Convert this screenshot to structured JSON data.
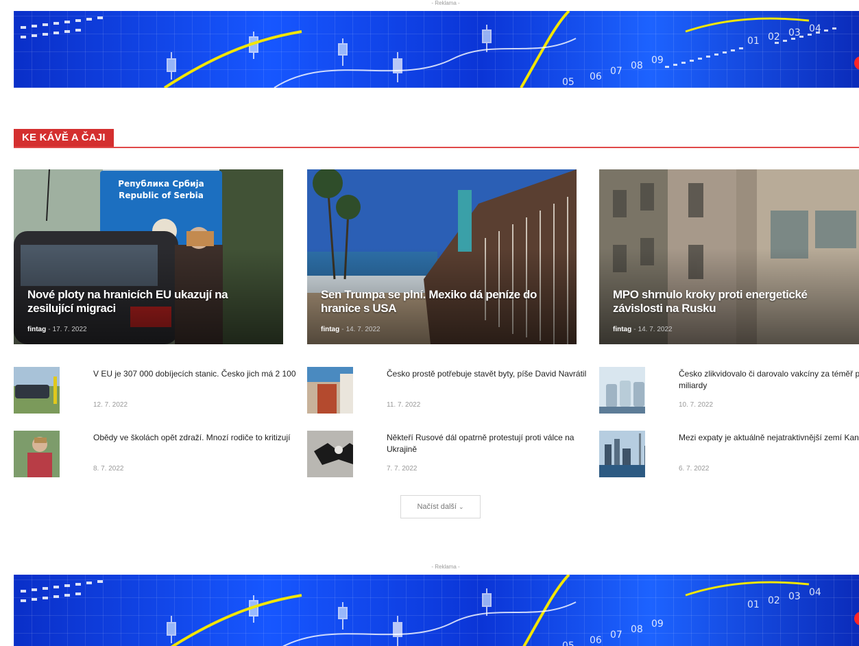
{
  "ads": {
    "top_label": "- Reklama -",
    "bottom_label": "- Reklama -",
    "banner_numbers": [
      "05",
      "06",
      "07",
      "08",
      "09",
      "01",
      "02",
      "03",
      "04"
    ]
  },
  "section": {
    "title": "KE KÁVĚ A ČAJI"
  },
  "features": [
    {
      "title": "Nové ploty na hranicích EU ukazují na zesilující migraci",
      "author": "fintag",
      "sep": "-",
      "date": "17. 7. 2022",
      "sign_line1": "Република Србија",
      "sign_line2": "Republic of Serbia"
    },
    {
      "title": "Sen Trumpa se plní. Mexiko dá peníze do hranice s USA",
      "author": "fintag",
      "sep": "-",
      "date": "14. 7. 2022"
    },
    {
      "title": "MPO shrnulo kroky proti energetické závislosti na Rusku",
      "author": "fintag",
      "sep": "-",
      "date": "14. 7. 2022"
    }
  ],
  "items": [
    {
      "title": "V EU je 307 000 dobíjecích stanic. Česko jich má 2 100",
      "date": "12. 7. 2022"
    },
    {
      "title": "Česko prostě potřebuje stavět byty, píše David Navrátil",
      "date": "11. 7. 2022"
    },
    {
      "title": "Česko zlikvidovalo či darovalo vakcíny za téměř půl miliardy",
      "date": "10. 7. 2022"
    },
    {
      "title": "Obědy ve školách opět zdraží. Mnozí rodiče to kritizují",
      "date": "8. 7. 2022"
    },
    {
      "title": "Někteří Rusové dál opatrně protestují proti válce na Ukrajině",
      "date": "7. 7. 2022"
    },
    {
      "title": "Mezi expaty je aktuálně nejatraktivnější zemí Kanada",
      "date": "6. 7. 2022"
    }
  ],
  "load_more": {
    "label": "Načíst další",
    "icon": "chevron-down-icon"
  }
}
